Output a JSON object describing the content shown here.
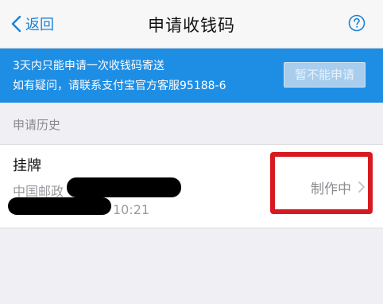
{
  "nav": {
    "back_label": "返回",
    "title": "申请收钱码",
    "help_icon": "question-circle-icon"
  },
  "notice": {
    "line1": "3天内只能申请一次收钱码寄送",
    "line2": "如有疑问，请联系支付宝官方客服95188-6",
    "button_label": "暂不能申请"
  },
  "history": {
    "section_label": "申请历史",
    "items": [
      {
        "title": "挂牌",
        "address": "中国邮政",
        "time": "10:21",
        "status": "制作中"
      }
    ]
  },
  "colors": {
    "accent": "#1b82d2",
    "notice_bg": "#1e8ee5",
    "highlight": "#d71a20",
    "background": "#efeff4"
  }
}
